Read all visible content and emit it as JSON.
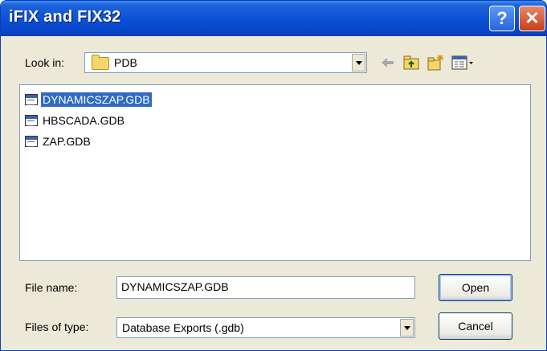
{
  "window": {
    "title": "iFIX and FIX32"
  },
  "titlebar": {
    "help_label": "?",
    "close_label": "✕"
  },
  "lookin": {
    "label": "Look in:",
    "value": "PDB"
  },
  "toolbar": {
    "icons": [
      "back-arrow-icon",
      "up-folder-icon",
      "new-folder-icon",
      "view-menu-icon"
    ]
  },
  "files": [
    {
      "name": "DYNAMICSZAP.GDB",
      "selected": true
    },
    {
      "name": "HBSCADA.GDB",
      "selected": false
    },
    {
      "name": "ZAP.GDB",
      "selected": false
    }
  ],
  "filename": {
    "label": "File name:",
    "value": "DYNAMICSZAP.GDB"
  },
  "filetype": {
    "label": "Files of type:",
    "value": "Database Exports (.gdb)"
  },
  "buttons": {
    "open": "Open",
    "cancel": "Cancel"
  },
  "colors": {
    "titlebar": "#0a50d6",
    "selection": "#316ac5",
    "dialog_bg": "#ece9d8"
  }
}
